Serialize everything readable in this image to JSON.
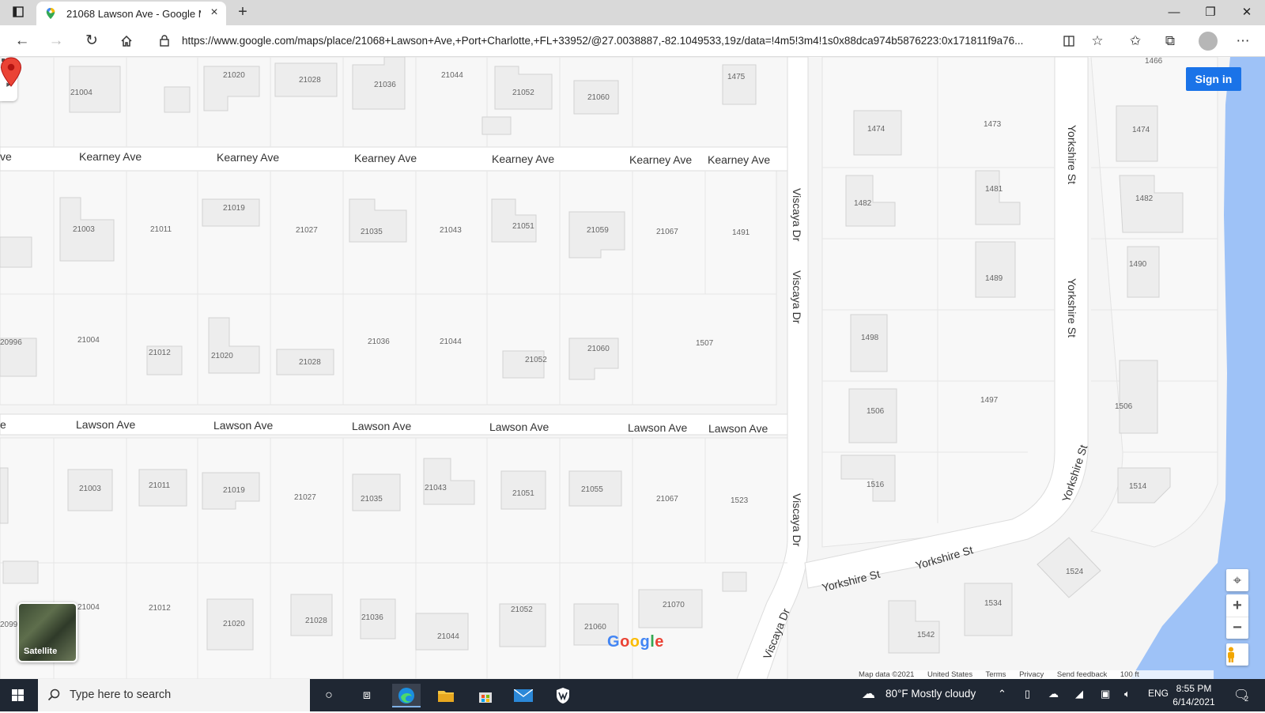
{
  "browser": {
    "tab": {
      "title": "21068 Lawson Ave - Google Maps",
      "favicon": "google-maps-pin-icon"
    },
    "url": "https://www.google.com/maps/place/21068+Lawson+Ave,+Port+Charlotte,+FL+33952/@27.0038887,-82.1049533,19z/data=!4m5!3m4!1s0x88dca974b5876223:0x171811f9a76...",
    "window_controls": {
      "minimize": "—",
      "maximize": "❐",
      "close": "✕"
    }
  },
  "map": {
    "signin_label": "Sign in",
    "satellite_label": "Satellite",
    "google_logo": "Google",
    "footer": {
      "map_data": "Map data ©2021",
      "country": "United States",
      "terms": "Terms",
      "privacy": "Privacy",
      "feedback": "Send feedback",
      "scale": "100 ft"
    },
    "streets": {
      "kearney": "Kearney Ave",
      "lawson": "Lawson Ave",
      "viscaya": "Viscaya Dr",
      "yorkshire": "Yorkshire St",
      "partial_ve": "ve",
      "partial_e": "e"
    },
    "lots": {
      "row1": [
        "21004",
        "21020",
        "21028",
        "21036",
        "21044",
        "21052",
        "21060",
        "1475"
      ],
      "row2": [
        "21003",
        "21011",
        "21019",
        "21027",
        "21035",
        "21043",
        "21051",
        "21059",
        "21067",
        "1491"
      ],
      "row3": [
        "20996",
        "21004",
        "21012",
        "21020",
        "21028",
        "21036",
        "21044",
        "21052",
        "21060",
        "1507"
      ],
      "row4": [
        "21003",
        "21011",
        "21019",
        "21027",
        "21035",
        "21043",
        "21051",
        "21055",
        "21067",
        "1523"
      ],
      "row5": [
        "2099",
        "21004",
        "21012",
        "21020",
        "21028",
        "21036",
        "21044",
        "21052",
        "21060",
        "21070"
      ],
      "east_a": [
        "1474",
        "1473",
        "1482",
        "1481",
        "1489",
        "1498",
        "1497",
        "1506",
        "1516"
      ],
      "east_b": [
        "1466",
        "1474",
        "1482",
        "1490",
        "1506",
        "1514",
        "1524",
        "1534",
        "1542"
      ]
    },
    "colors": {
      "water": "#9ec2f7",
      "pin": "#ea4335",
      "signin": "#1a73e8"
    }
  },
  "taskbar": {
    "search_placeholder": "Type here to search",
    "weather": "80°F  Mostly cloudy",
    "language": "ENG",
    "time": "8:55 PM",
    "date": "6/14/2021",
    "notifications": "2"
  }
}
